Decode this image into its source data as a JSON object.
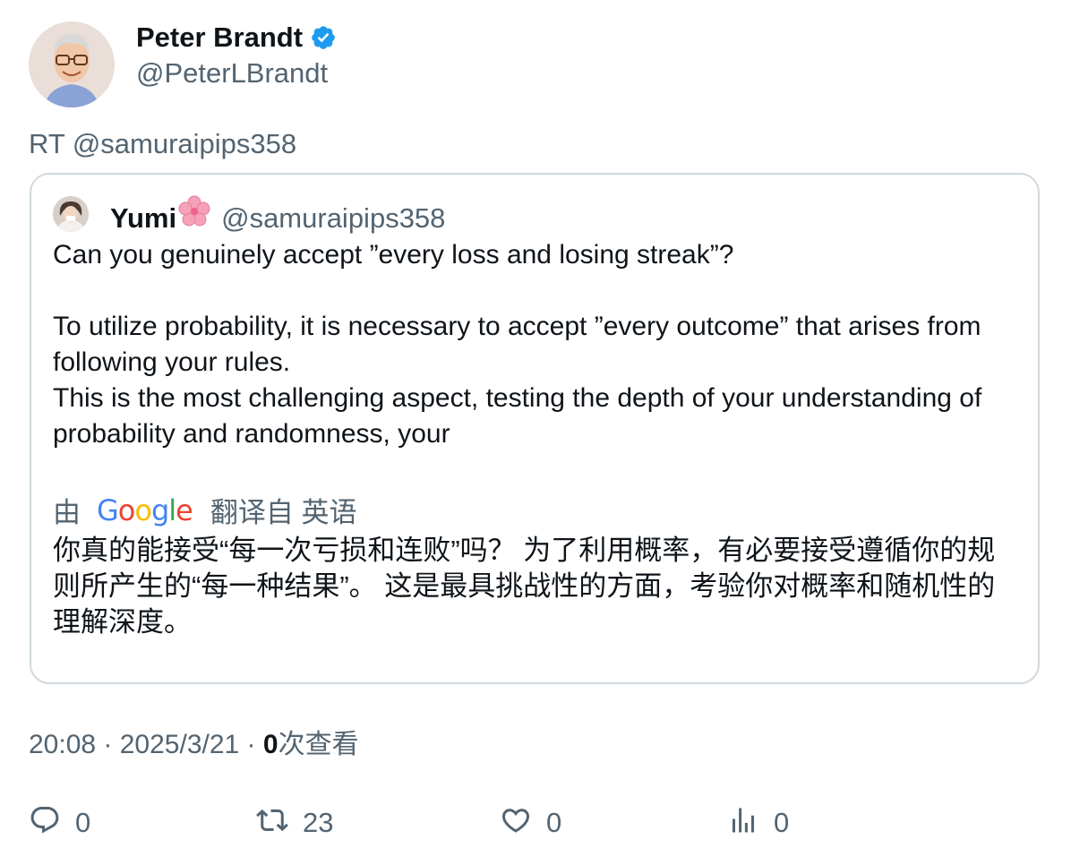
{
  "author": {
    "display_name": "Peter Brandt",
    "handle": "@PeterLBrandt",
    "verified_color": "#1d9bf0"
  },
  "retweet_line": "RT @samuraipips358",
  "quote": {
    "display_name": "Yumi",
    "emoji": "🌸",
    "handle": "@samuraipips358",
    "body": "Can you genuinely accept ”every loss and losing streak”?\n\nTo utilize probability, it is necessary to accept ”every outcome” that arises from following your rules.\nThis is the most challenging aspect, testing the depth of your understanding of probability and randomness, your",
    "translate_by": "由",
    "translate_provider": "Google",
    "translate_from": "翻译自 英语",
    "translated_body": "你真的能接受“每一次亏损和连败”吗？ 为了利用概率，有必要接受遵循你的规则所产生的“每一种结果”。 这是最具挑战性的方面，考验你对概率和随机性的理解深度。"
  },
  "meta": {
    "time": "20:08",
    "separator": " · ",
    "date": "2025/3/21",
    "views_count": "0",
    "views_label": "次查看"
  },
  "actions": {
    "replies": "0",
    "retweets": "23",
    "likes": "0",
    "views": "0"
  }
}
